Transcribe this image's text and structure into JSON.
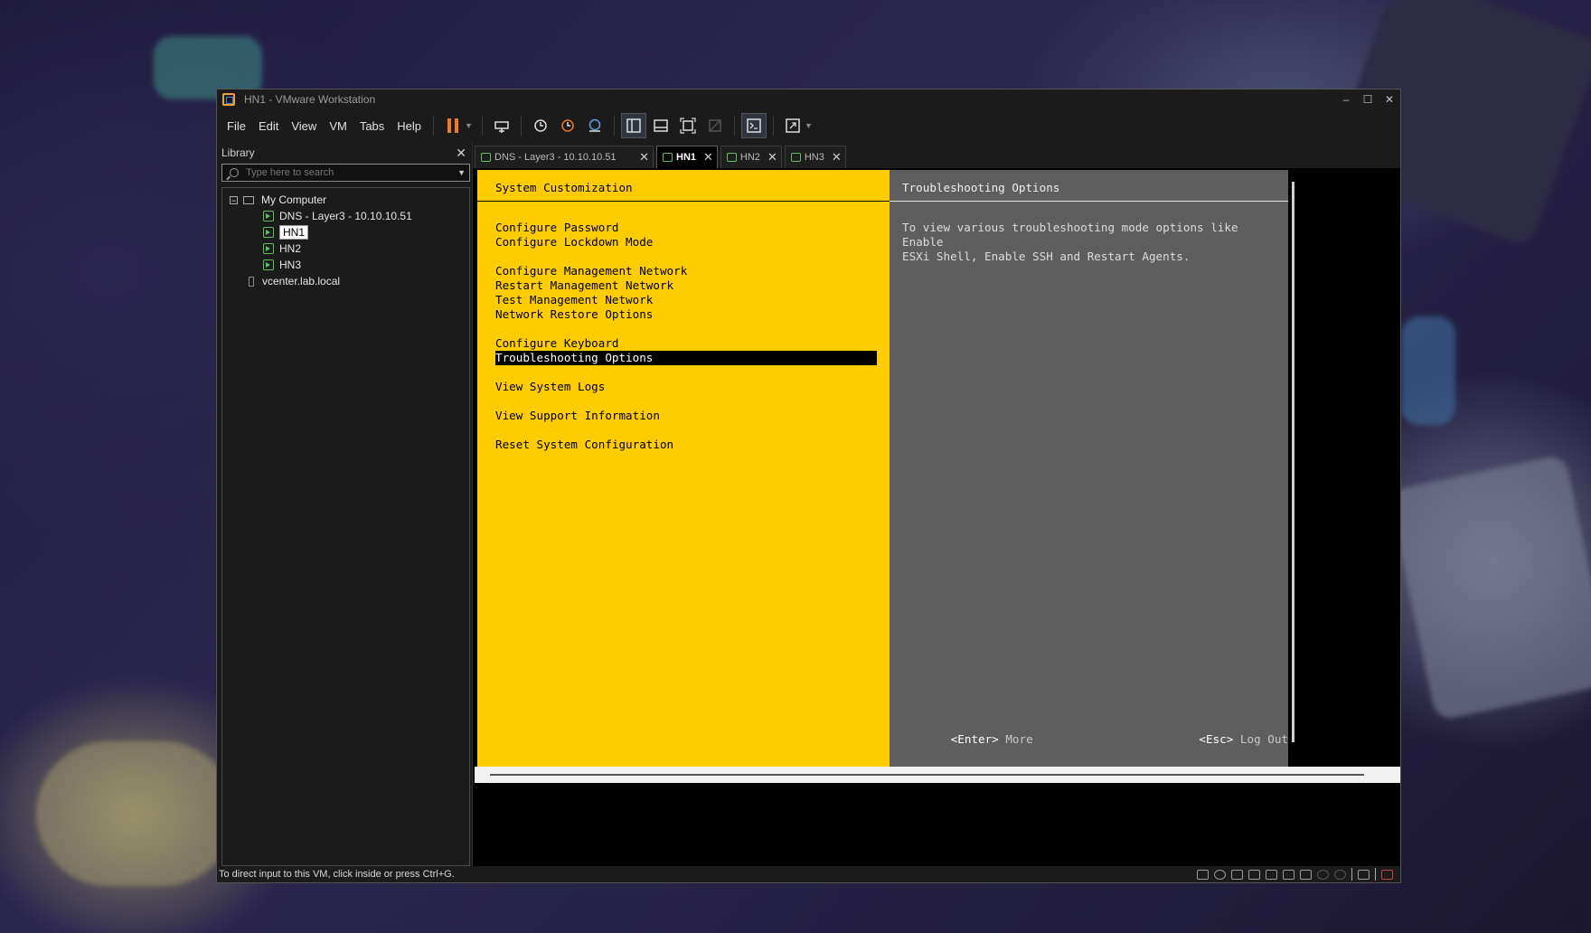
{
  "window": {
    "title": "HN1 - VMware Workstation",
    "controls": [
      "–",
      "☐",
      "✕"
    ]
  },
  "menu": [
    "File",
    "Edit",
    "View",
    "VM",
    "Tabs",
    "Help"
  ],
  "toolbar": {
    "icons": [
      "pause-icon",
      "send-ctrl-alt-del-icon",
      "snapshot-icon",
      "revert-snapshot-icon",
      "snapshot-manager-icon",
      "show-library-icon",
      "thumbnail-bar-icon",
      "full-screen-icon",
      "unity-icon",
      "console-view-icon",
      "stretch-guest-icon"
    ]
  },
  "library": {
    "title": "Library",
    "close": "✕",
    "search_placeholder": "Type here to search",
    "root": "My Computer",
    "root_expander": "−",
    "vms": [
      "DNS - Layer3 - 10.10.10.51",
      "HN1",
      "HN2",
      "HN3"
    ],
    "selected": "HN1",
    "host": "vcenter.lab.local"
  },
  "tabs": [
    {
      "label": "DNS - Layer3 - 10.10.10.51",
      "close": "✕"
    },
    {
      "label": "HN1",
      "close": "✕"
    },
    {
      "label": "HN2",
      "close": "✕"
    },
    {
      "label": "HN3",
      "close": "✕"
    }
  ],
  "dcui": {
    "left_title": "System Customization",
    "right_title": "Troubleshooting Options",
    "items": [
      "Configure Password",
      "Configure Lockdown Mode",
      "Configure Management Network",
      "Restart Management Network",
      "Test Management Network",
      "Network Restore Options",
      "Configure Keyboard",
      "Troubleshooting Options",
      "View System Logs",
      "View Support Information",
      "Reset System Configuration"
    ],
    "selected_item": "Troubleshooting Options",
    "description": "To view various troubleshooting mode options like Enable\nESXi Shell, Enable SSH and Restart Agents.",
    "enter_key": "<Enter>",
    "enter_action": "More",
    "esc_key": "<Esc>",
    "esc_action": "Log Out"
  },
  "status": {
    "message": "To direct input to this VM, click inside or press Ctrl+G."
  },
  "colors": {
    "dcui_yellow": "#ffcc00",
    "dcui_gray": "#5e5e5e",
    "pause_orange": "#f07a1e"
  }
}
